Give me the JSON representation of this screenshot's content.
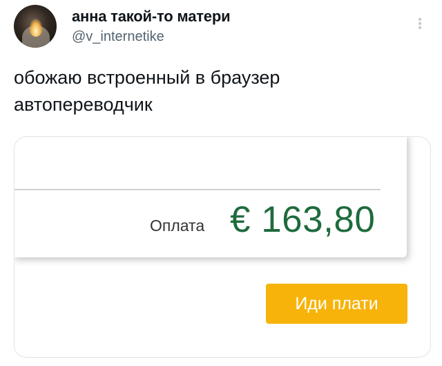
{
  "tweet": {
    "author": {
      "display_name": "анна такой-то матери",
      "handle": "@v_internetike"
    },
    "text": "обожаю встроенный в браузер автопереводчик",
    "more_icon": "vertical-ellipsis-icon"
  },
  "media": {
    "total_label": "Оплата",
    "total_amount": "€ 163,80",
    "pay_button_label": "Иди плати",
    "colors": {
      "amount": "#1e6b3d",
      "button": "#f7b30a"
    }
  }
}
